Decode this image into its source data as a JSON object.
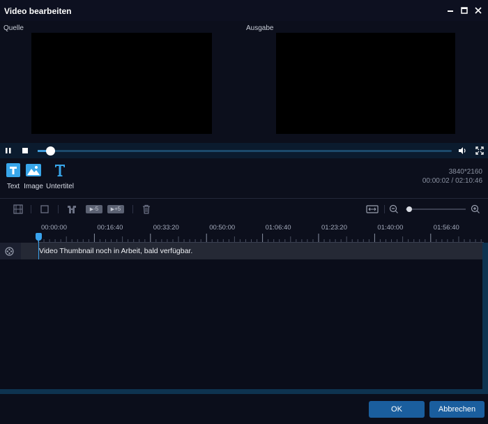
{
  "window": {
    "title": "Video bearbeiten"
  },
  "preview": {
    "source_label": "Quelle",
    "output_label": "Ausgabe"
  },
  "player": {
    "progress": 0.02
  },
  "tools": [
    {
      "label": "Text",
      "icon": "text-icon"
    },
    {
      "label": "Image",
      "icon": "image-icon"
    },
    {
      "label": "Untertitel",
      "icon": "subtitle-icon"
    }
  ],
  "info": {
    "resolution": "3840*2160",
    "time": "00:00:02 / 02:10:46"
  },
  "timeline": {
    "toolbar": {
      "minus5": "-5",
      "plus5": "+5"
    },
    "ticks": [
      "00:00:00",
      "00:16:40",
      "00:33:20",
      "00:50:00",
      "01:06:40",
      "01:23:20",
      "01:40:00",
      "01:56:40"
    ],
    "track_text": "Video Thumbnail noch in Arbeit, bald verfügbar.",
    "zoom_level": 0.05
  },
  "buttons": {
    "ok": "OK",
    "cancel": "Abbrechen"
  },
  "colors": {
    "accent": "#3a9fe6",
    "button": "#1a5e9e",
    "background": "#0c0f1c"
  }
}
